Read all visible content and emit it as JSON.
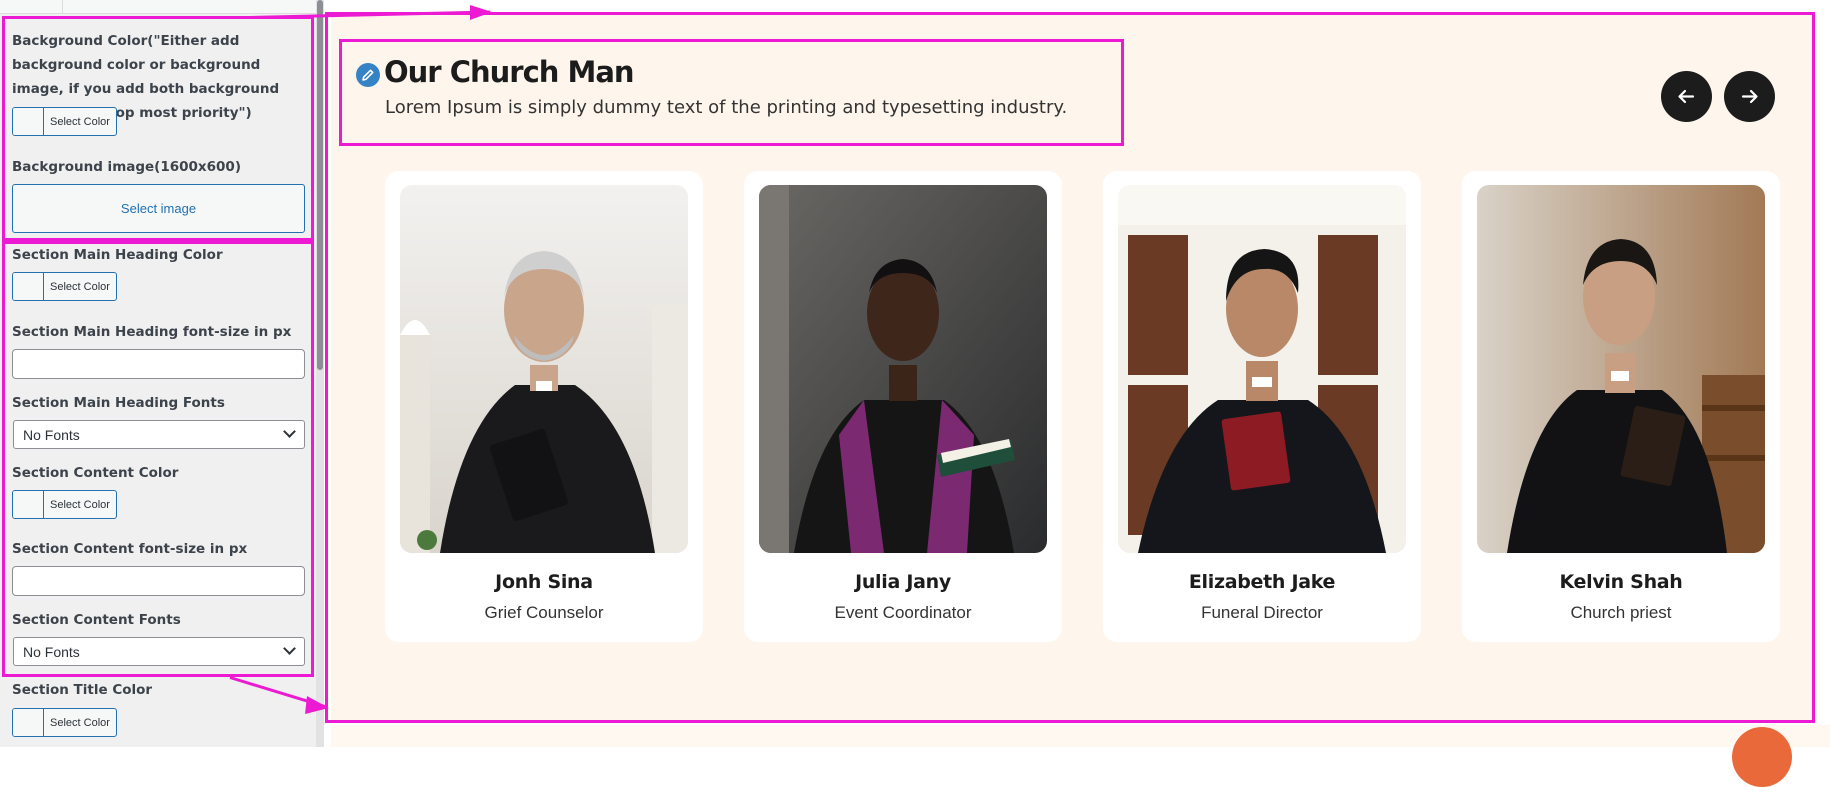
{
  "settings": {
    "bg_color_label": "Background Color(\"Either add background color or background image, if you add both background color will be top most priority\")",
    "select_color": "Select Color",
    "bg_image_label": "Background image(1600x600)",
    "select_image": "Select image",
    "heading_color_label": "Section Main Heading Color",
    "heading_fontsize_label": "Section Main Heading font-size in px",
    "heading_fonts_label": "Section Main Heading Fonts",
    "fonts_value": "No Fonts",
    "content_color_label": "Section Content Color",
    "content_fontsize_label": "Section Content font-size in px",
    "content_fonts_label": "Section Content Fonts",
    "title_color_label": "Section Title Color"
  },
  "section": {
    "title": "Our Church Man",
    "subtitle": "Lorem Ipsum is simply dummy text of the printing and typesetting industry.",
    "background": "#fef6ec"
  },
  "cards": [
    {
      "name": "Jonh Sina",
      "role": "Grief Counselor",
      "icon": "person-photo"
    },
    {
      "name": "Julia Jany",
      "role": "Event Coordinator",
      "icon": "person-photo"
    },
    {
      "name": "Elizabeth Jake",
      "role": "Funeral Director",
      "icon": "person-photo"
    },
    {
      "name": "Kelvin Shah",
      "role": "Church priest",
      "icon": "person-photo"
    }
  ],
  "icons": {
    "prev": "arrow-left-icon",
    "next": "arrow-right-icon",
    "edit": "pencil-icon"
  },
  "colors": {
    "accent": "#2271b1",
    "annotation": "#ec1bd3",
    "nav": "#1c1c1c",
    "fab": "#e9693b"
  }
}
